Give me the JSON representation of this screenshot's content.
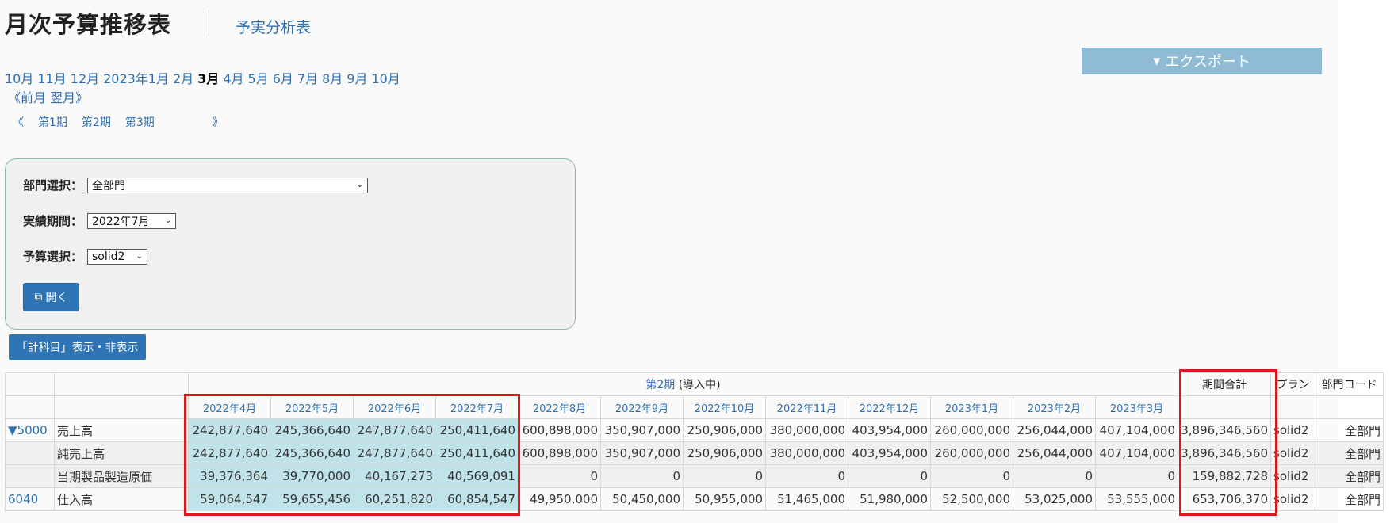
{
  "header": {
    "title": "月次予算推移表",
    "subtitle_link": "予実分析表",
    "export_label": "エクスポート"
  },
  "months_nav": {
    "items": [
      "10月",
      "11月",
      "12月",
      "2023年1月",
      "2月",
      "3月",
      "4月",
      "5月",
      "6月",
      "7月",
      "8月",
      "9月",
      "10月"
    ],
    "current": "3月",
    "prev_label": "《前月",
    "next_label": "翌月》"
  },
  "period_nav": {
    "open": "《",
    "items": [
      "第1期",
      "第2期",
      "第3期"
    ],
    "close": "》"
  },
  "filters": {
    "department_label": "部門選択：",
    "department_value": "全部門",
    "actual_period_label": "実績期間：",
    "actual_period_value": "2022年7月",
    "budget_label": "予算選択：",
    "budget_value": "solid2",
    "open_button": "開く"
  },
  "toggle_button": "「計科目」表示・非表示",
  "table": {
    "period_header_link": "第2期",
    "period_header_status": "(導入中)",
    "months": [
      "2022年4月",
      "2022年5月",
      "2022年6月",
      "2022年7月",
      "2022年8月",
      "2022年9月",
      "2022年10月",
      "2022年11月",
      "2022年12月",
      "2023年1月",
      "2023年2月",
      "2023年3月"
    ],
    "total_header": "期間合計",
    "plan_header": "プラン",
    "dept_header": "部門コード",
    "rows": [
      {
        "code": "▼5000",
        "name": "売上高",
        "values": [
          "242,877,640",
          "245,366,640",
          "247,877,640",
          "250,411,640",
          "600,898,000",
          "350,907,000",
          "250,906,000",
          "380,000,000",
          "403,954,000",
          "260,000,000",
          "256,044,000",
          "407,104,000"
        ],
        "total": "3,896,346,560",
        "plan": "solid2",
        "dept": "全部門"
      },
      {
        "code": "",
        "name": "純売上高",
        "values": [
          "242,877,640",
          "245,366,640",
          "247,877,640",
          "250,411,640",
          "600,898,000",
          "350,907,000",
          "250,906,000",
          "380,000,000",
          "403,954,000",
          "260,000,000",
          "256,044,000",
          "407,104,000"
        ],
        "total": "3,896,346,560",
        "plan": "solid2",
        "dept": "全部門"
      },
      {
        "code": "",
        "name": "当期製品製造原価",
        "values": [
          "39,376,364",
          "39,770,000",
          "40,167,273",
          "40,569,091",
          "0",
          "0",
          "0",
          "0",
          "0",
          "0",
          "0",
          "0"
        ],
        "total": "159,882,728",
        "plan": "solid2",
        "dept": "全部門"
      },
      {
        "code": "6040",
        "name": "仕入高",
        "values": [
          "59,064,547",
          "59,655,456",
          "60,251,820",
          "60,854,547",
          "49,950,000",
          "50,450,000",
          "50,955,000",
          "51,465,000",
          "51,980,000",
          "52,500,000",
          "53,025,000",
          "53,555,000"
        ],
        "total": "653,706,370",
        "plan": "solid2",
        "dept": "全部門"
      }
    ]
  }
}
